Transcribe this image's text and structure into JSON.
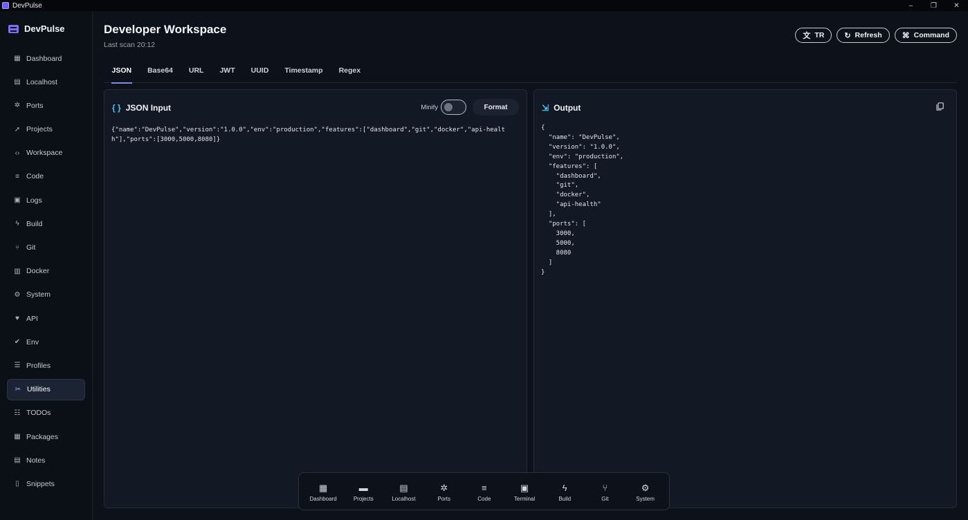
{
  "window": {
    "title": "DevPulse",
    "minimize": "–",
    "restore": "❐",
    "close": "✕"
  },
  "brand": {
    "name": "DevPulse"
  },
  "sidebar": {
    "items": [
      {
        "label": "Dashboard",
        "icon": "▦",
        "name": "dashboard"
      },
      {
        "label": "Localhost",
        "icon": "▤",
        "name": "localhost"
      },
      {
        "label": "Ports",
        "icon": "✲",
        "name": "ports"
      },
      {
        "label": "Projects",
        "icon": "➚",
        "name": "projects"
      },
      {
        "label": "Workspace",
        "icon": "‹›",
        "name": "workspace"
      },
      {
        "label": "Code",
        "icon": "≡",
        "name": "code"
      },
      {
        "label": "Logs",
        "icon": "▣",
        "name": "logs"
      },
      {
        "label": "Build",
        "icon": "ϟ",
        "name": "build"
      },
      {
        "label": "Git",
        "icon": "⑂",
        "name": "git"
      },
      {
        "label": "Docker",
        "icon": "▥",
        "name": "docker"
      },
      {
        "label": "System",
        "icon": "⚙",
        "name": "system"
      },
      {
        "label": "API",
        "icon": "♥",
        "name": "api"
      },
      {
        "label": "Env",
        "icon": "✔",
        "name": "env"
      },
      {
        "label": "Profiles",
        "icon": "☰",
        "name": "profiles"
      },
      {
        "label": "Utilities",
        "icon": "✂",
        "name": "utilities",
        "active": true
      },
      {
        "label": "TODOs",
        "icon": "☷",
        "name": "todos"
      },
      {
        "label": "Packages",
        "icon": "▦",
        "name": "packages"
      },
      {
        "label": "Notes",
        "icon": "▤",
        "name": "notes"
      },
      {
        "label": "Snippets",
        "icon": "▯",
        "name": "snippets"
      }
    ]
  },
  "header": {
    "title": "Developer Workspace",
    "subtitle": "Last scan 20:12"
  },
  "actions": {
    "lang": "TR",
    "refresh": "Refresh",
    "command": "Command"
  },
  "tabs": [
    "JSON",
    "Base64",
    "URL",
    "JWT",
    "UUID",
    "Timestamp",
    "Regex"
  ],
  "input_panel": {
    "title": "JSON Input",
    "minify_label": "Minify",
    "minify_on": false,
    "format_label": "Format",
    "value": "{\"name\":\"DevPulse\",\"version\":\"1.0.0\",\"env\":\"production\",\"features\":[\"dashboard\",\"git\",\"docker\",\"api-health\"],\"ports\":[3000,5000,8080]}"
  },
  "output_panel": {
    "title": "Output",
    "value": "{\n  \"name\": \"DevPulse\",\n  \"version\": \"1.0.0\",\n  \"env\": \"production\",\n  \"features\": [\n    \"dashboard\",\n    \"git\",\n    \"docker\",\n    \"api-health\"\n  ],\n  \"ports\": [\n    3000,\n    5000,\n    8080\n  ]\n}"
  },
  "dock": {
    "items": [
      {
        "label": "Dashboard",
        "icon": "▦",
        "name": "dashboard"
      },
      {
        "label": "Projects",
        "icon": "▬",
        "name": "projects"
      },
      {
        "label": "Localhost",
        "icon": "▤",
        "name": "localhost"
      },
      {
        "label": "Ports",
        "icon": "✲",
        "name": "ports"
      },
      {
        "label": "Code",
        "icon": "≡",
        "name": "code"
      },
      {
        "label": "Terminal",
        "icon": "▣",
        "name": "terminal"
      },
      {
        "label": "Build",
        "icon": "ϟ",
        "name": "build"
      },
      {
        "label": "Git",
        "icon": "⑂",
        "name": "git"
      },
      {
        "label": "System",
        "icon": "⚙",
        "name": "system"
      }
    ]
  },
  "colors": {
    "accent": "#7d6df5",
    "tab_underline": "#7d8fe8",
    "panel_icon": "#4fc3f7",
    "bg": "#0d1119",
    "panel": "#121824"
  }
}
